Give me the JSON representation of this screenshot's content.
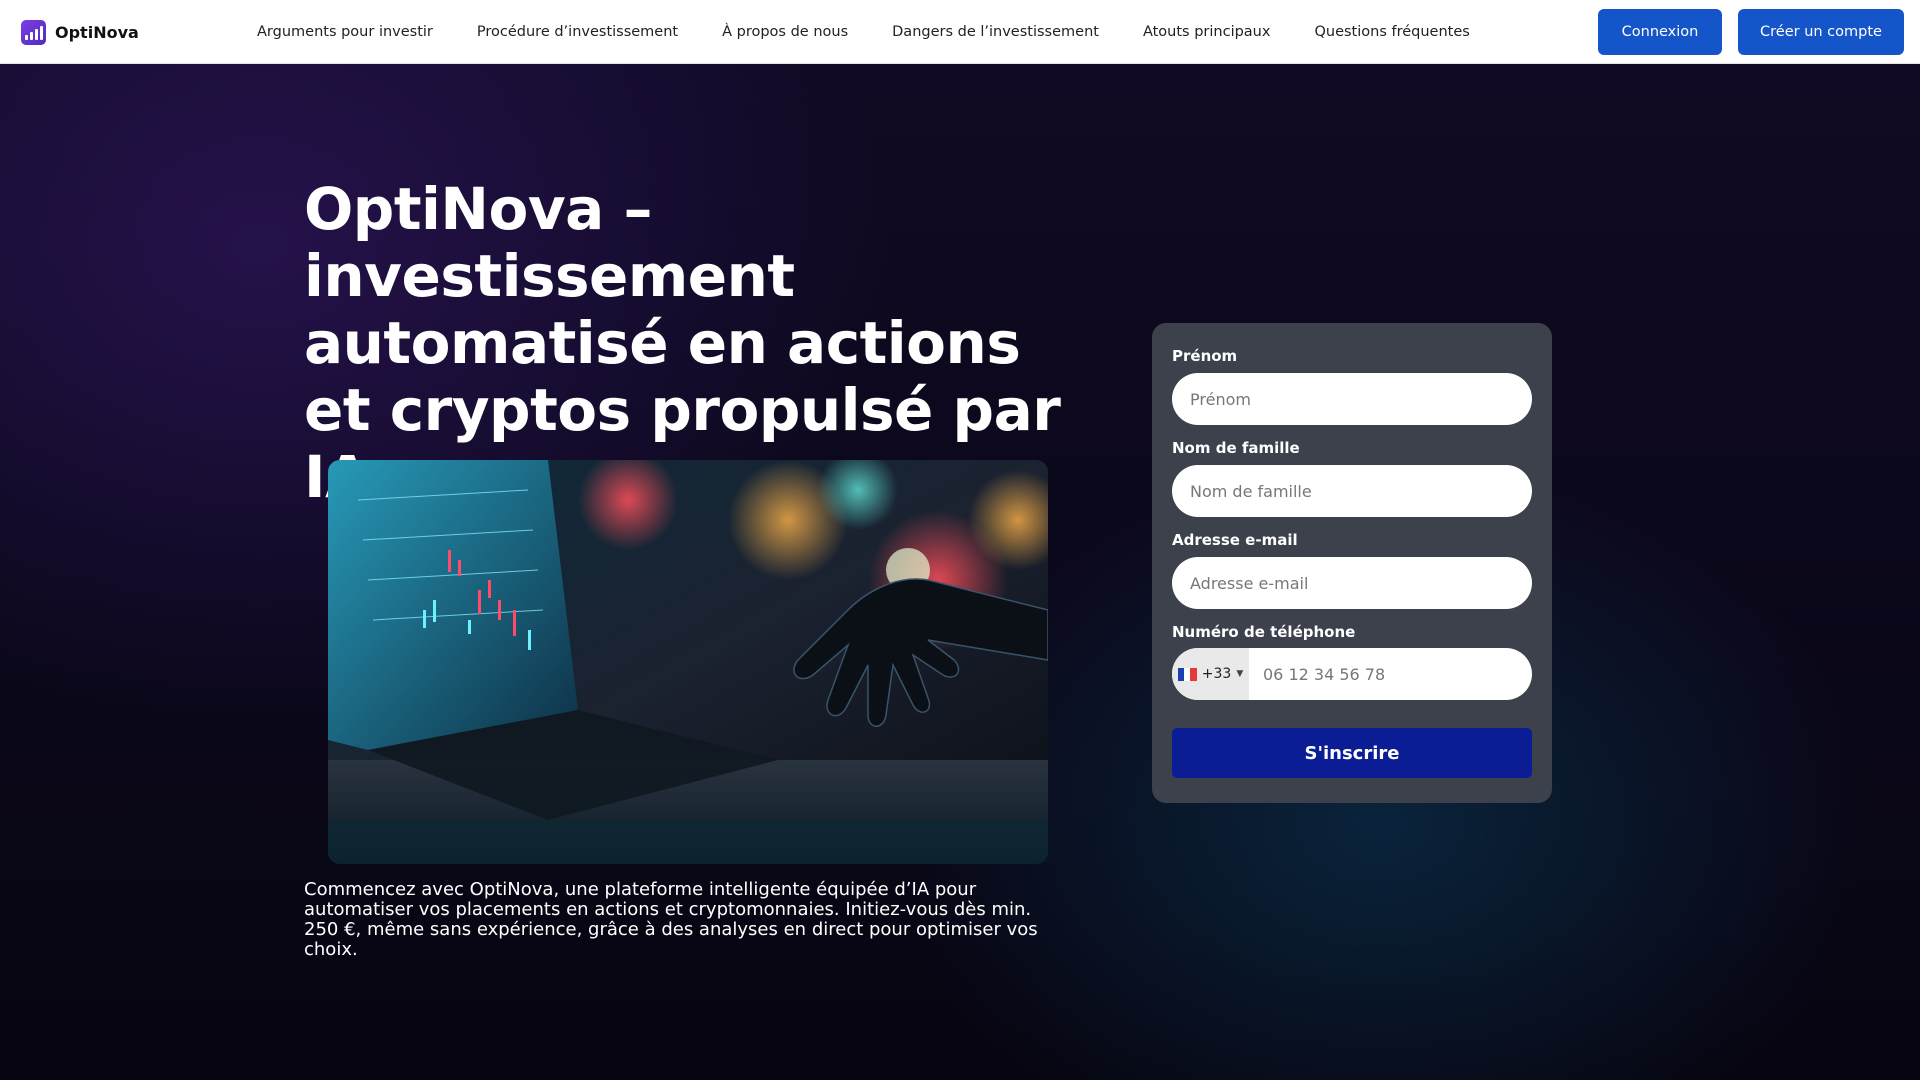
{
  "header": {
    "brand": "OptiNova",
    "nav": [
      "Arguments pour investir",
      "Procédure d’investissement",
      "À propos de nous",
      "Dangers de l’investissement",
      "Atouts principaux",
      "Questions fréquentes"
    ],
    "login_label": "Connexion",
    "signup_label": "Créer un compte"
  },
  "hero": {
    "title": "OptiNova – investissement automatisé en actions et cryptos propulsé par IA",
    "description": "Commencez avec OptiNova, une plateforme intelligente équipée d’IA pour automatiser vos placements en actions et cryptomonnaies. Initiez-vous dès min. 250 €, même sans expérience, grâce à des analyses en direct pour optimiser vos choix.",
    "image_icon": "ai-robot-hand-trading-laptop-image"
  },
  "form": {
    "first_name_label": "Prénom",
    "first_name_placeholder": "Prénom",
    "last_name_label": "Nom de famille",
    "last_name_placeholder": "Nom de famille",
    "email_label": "Adresse e-mail",
    "email_placeholder": "Adresse e-mail",
    "phone_label": "Numéro de téléphone",
    "phone_country_code": "+33",
    "phone_country_flag": "france-flag-icon",
    "phone_placeholder": "06 12 34 56 78",
    "submit_label": "S'inscrire"
  },
  "colors": {
    "primary_button": "#1455c9",
    "submit_button": "#0a1d94",
    "form_card": "#3c414c",
    "brand_logo": "#6a35d8"
  }
}
